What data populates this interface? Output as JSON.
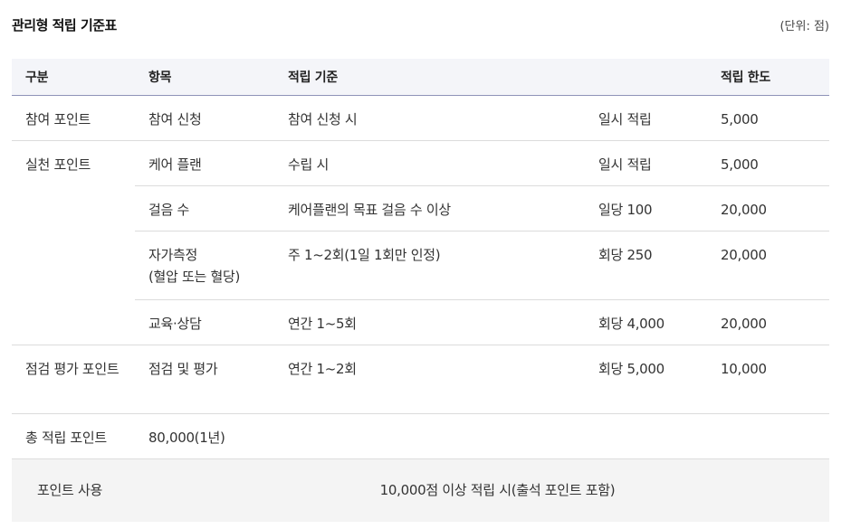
{
  "title": "관리형 적립 기준표",
  "unit": "(단위: 점)",
  "table": {
    "headers": [
      "구분",
      "항목",
      "적립 기준",
      "",
      "적립 한도"
    ],
    "rows": [
      {
        "category": "참여 포인트",
        "item": "참여 신청",
        "criteria": "참여 신청 시",
        "rate": "일시 적립",
        "limit": "5,000"
      },
      {
        "category": "실천 포인트",
        "item": "케어 플랜",
        "criteria": "수립 시",
        "rate": "일시 적립",
        "limit": "5,000"
      },
      {
        "category": "",
        "item": "걸음 수",
        "criteria": "케어플랜의 목표 걸음 수 이상",
        "rate": "일당 100",
        "limit": "20,000"
      },
      {
        "category": "",
        "item_line1": "자가측정",
        "item_line2": "(혈압 또는 혈당)",
        "criteria": "주 1~2회(1일 1회만 인정)",
        "rate": "회당 250",
        "limit": "20,000"
      },
      {
        "category": "",
        "item": "교육·상담",
        "criteria": "연간 1~5회",
        "rate": "회당 4,000",
        "limit": "20,000"
      },
      {
        "category": "점검 평가 포인트",
        "item": "점검 및 평가",
        "criteria": "연간 1~2회",
        "rate": "회당 5,000",
        "limit": "10,000"
      }
    ],
    "total": {
      "label": "총 적립 포인트",
      "value": "80,000(1년)"
    },
    "usage": {
      "label": "포인트 사용",
      "value": "10,000점 이상 적립 시(출석 포인트 포함)"
    }
  }
}
